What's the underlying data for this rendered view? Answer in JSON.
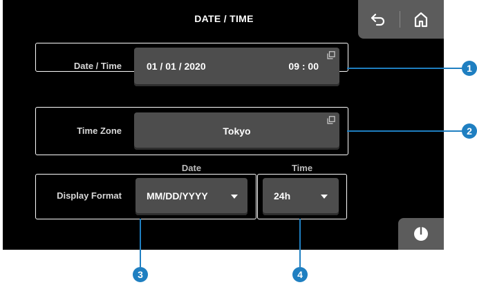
{
  "header": {
    "title": "DATE / TIME"
  },
  "nav": {
    "back_icon": "back-arrow-icon",
    "home_icon": "home-icon"
  },
  "date_time": {
    "label": "Date / Time",
    "date": "01 / 01 / 2020",
    "time": "09 : 00",
    "icon": "open-popup-icon"
  },
  "time_zone": {
    "label": "Time Zone",
    "value": "Tokyo",
    "icon": "open-popup-icon"
  },
  "display_format": {
    "label": "Display Format",
    "date_header": "Date",
    "time_header": "Time",
    "date_value": "MM/DD/YYYY",
    "time_value": "24h"
  },
  "corner_button": {
    "icon": "power-icon"
  },
  "callouts": [
    "1",
    "2",
    "3",
    "4"
  ],
  "colors": {
    "screen_bg": "#000000",
    "field_bg": "#4d4d4d",
    "nav_bg": "#5c5c5c",
    "callout": "#1f7fc1"
  }
}
